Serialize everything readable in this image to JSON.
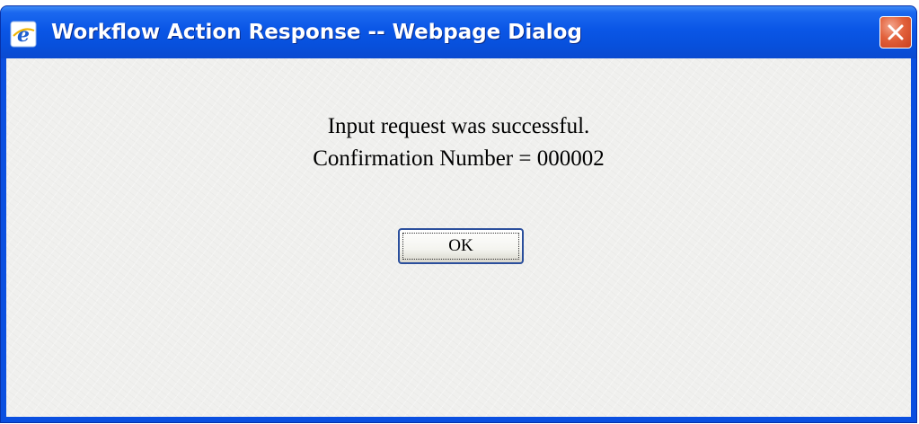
{
  "window": {
    "title": "Workflow Action Response -- Webpage Dialog",
    "icon": "ie-icon",
    "close_icon": "close-icon"
  },
  "message": {
    "line1": "Input request was successful.",
    "line2": "Confirmation Number = 000002"
  },
  "buttons": {
    "ok_label": "OK"
  },
  "colors": {
    "title_bar": "#0a56e6",
    "close_button": "#e2613b",
    "dialog_background": "#f0f0ee"
  }
}
